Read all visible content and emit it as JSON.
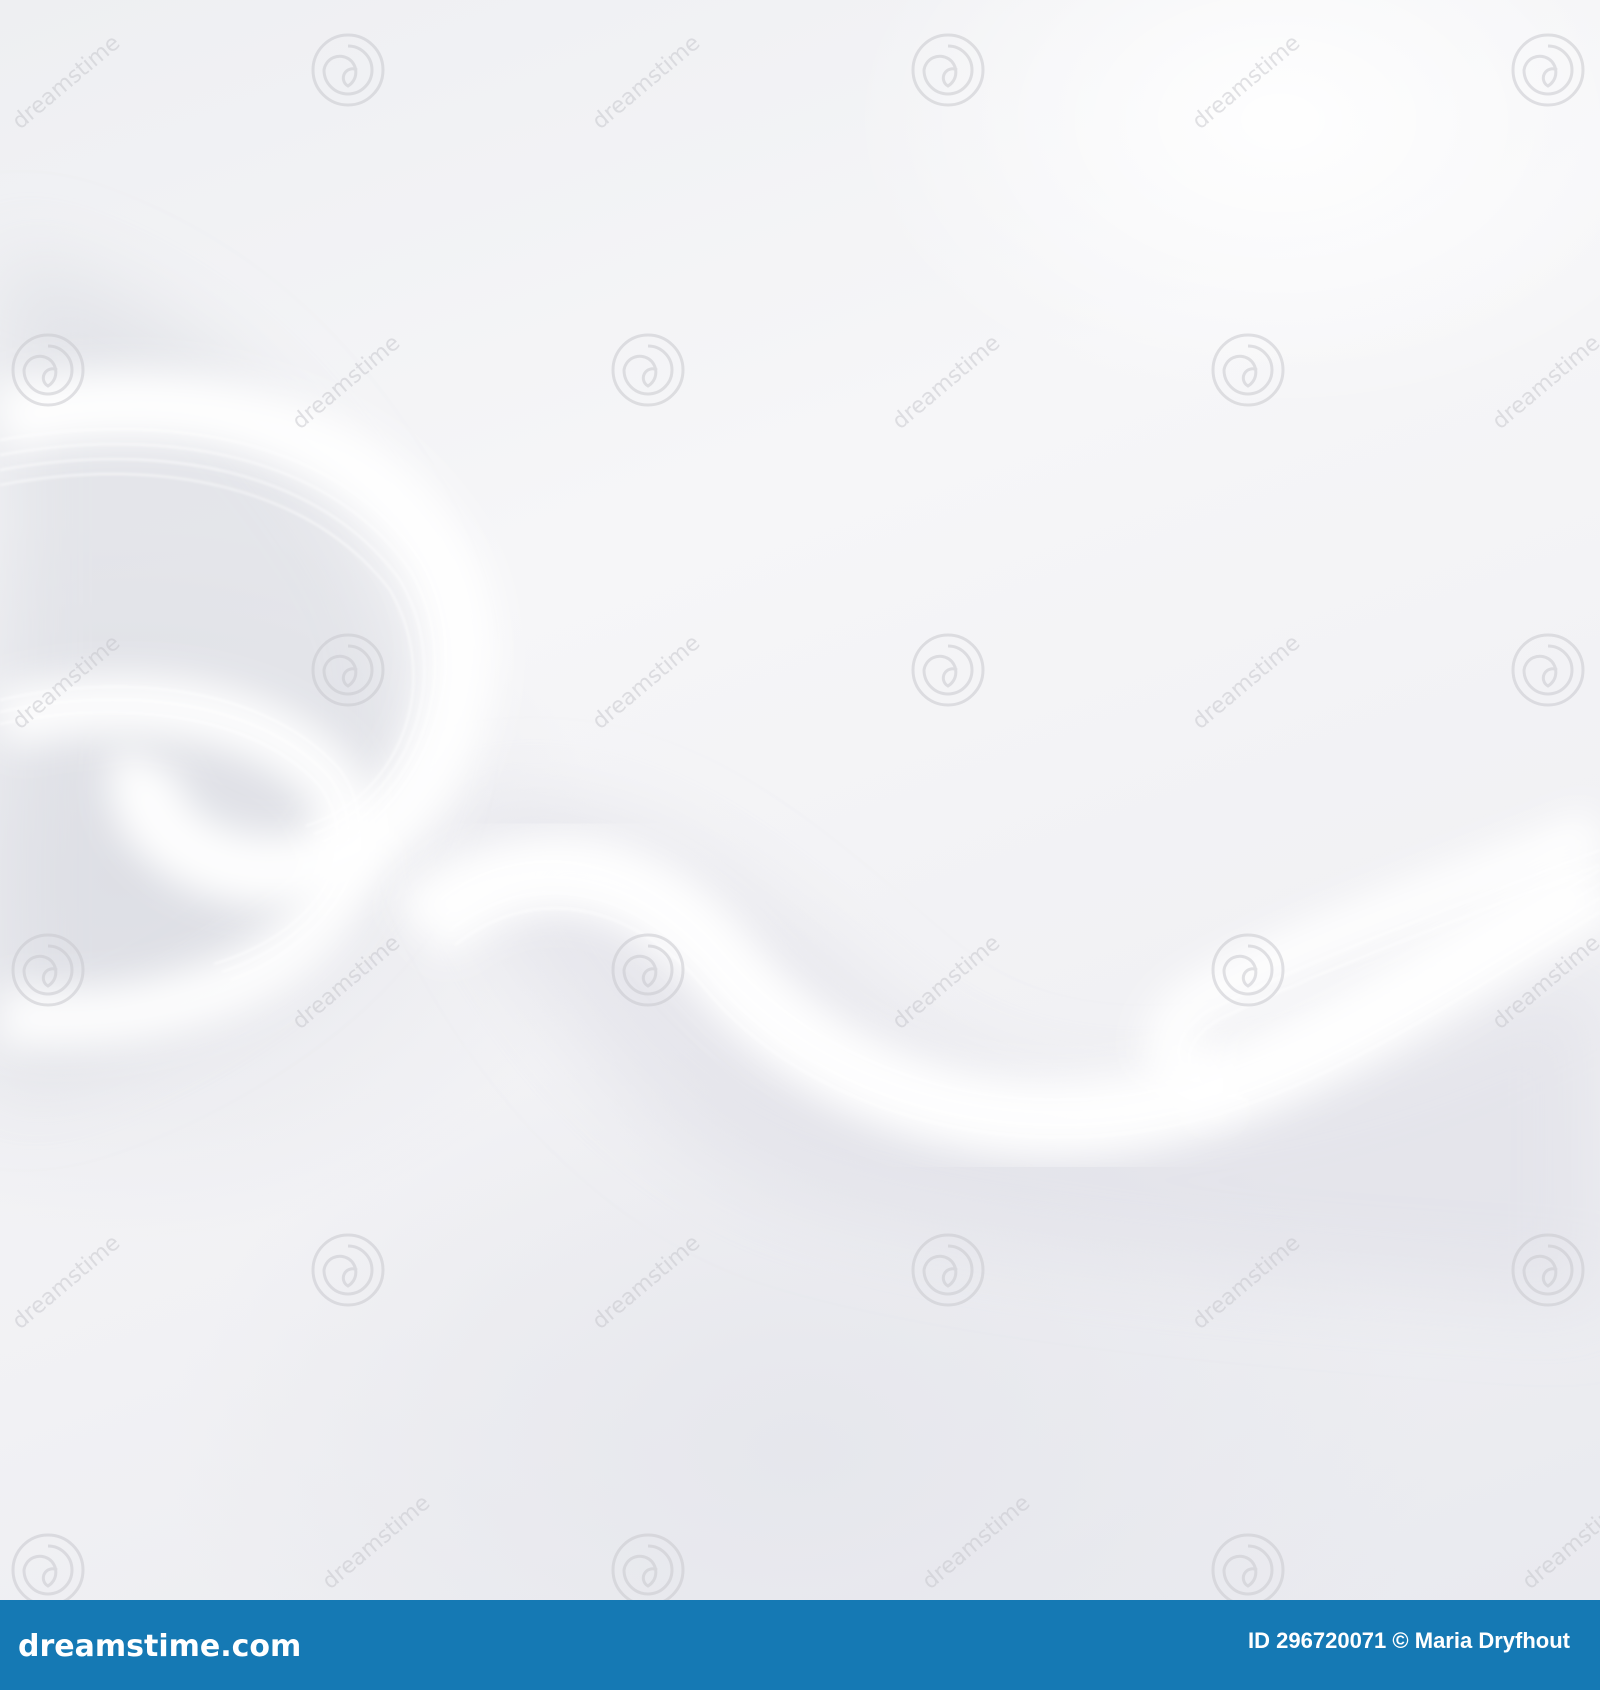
{
  "photo": {
    "subject": "abstract-white-silk-waves",
    "watermark_icon": "spiral-watermark-icon",
    "watermark_text": "dreamstime"
  },
  "footer": {
    "brand": "dreamstime.com",
    "image_id": "ID 296720071",
    "copyright_symbol": "©",
    "author": "Maria Dryfhout",
    "bar_color": "#1579b4"
  }
}
